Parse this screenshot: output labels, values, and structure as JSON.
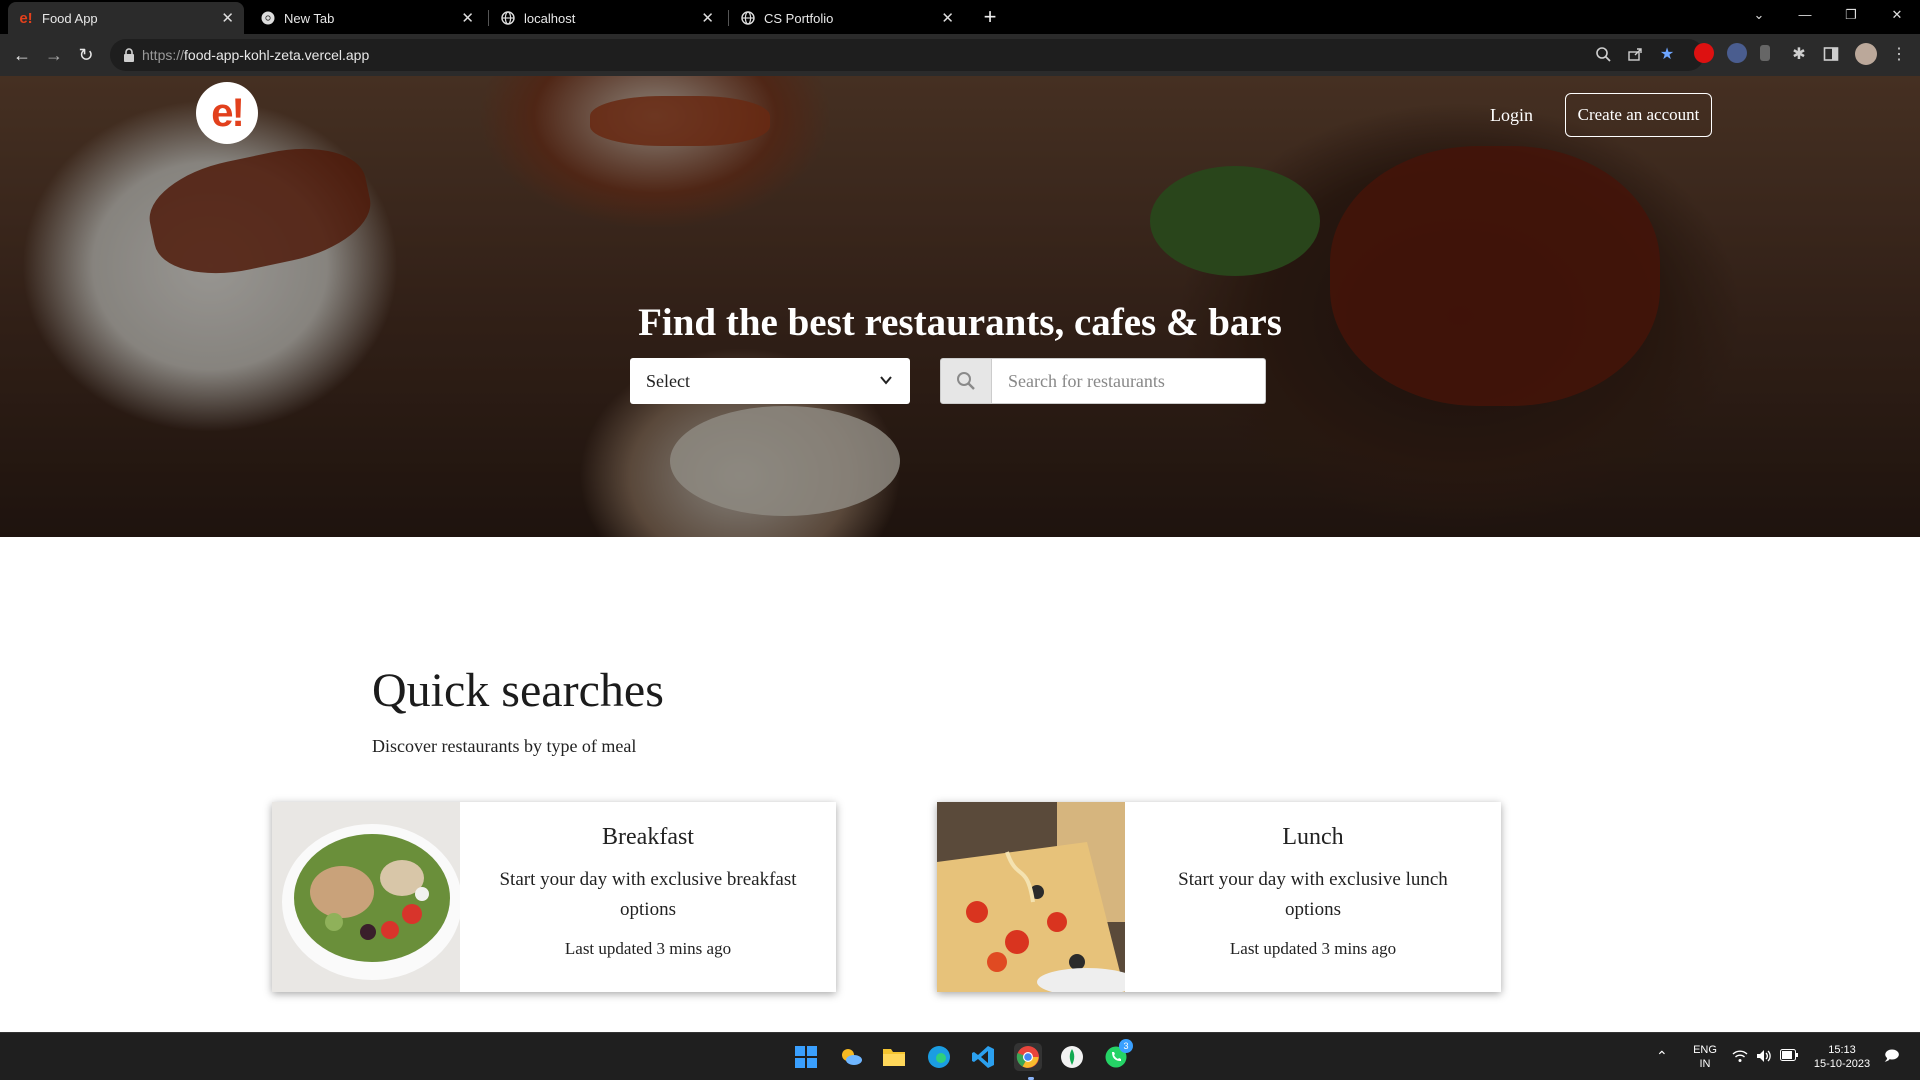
{
  "browser": {
    "tabs": [
      {
        "title": "Food App",
        "active": true,
        "favicon": "e!"
      },
      {
        "title": "New Tab",
        "active": false,
        "favicon": "chrome-icon"
      },
      {
        "title": "localhost",
        "active": false,
        "favicon": "globe-icon"
      },
      {
        "title": "CS Portfolio",
        "active": false,
        "favicon": "globe-icon"
      }
    ],
    "url_scheme": "https://",
    "url_host": "food-app-kohl-zeta.vercel.app"
  },
  "header": {
    "logo": "e!",
    "login_label": "Login",
    "create_account_label": "Create an account"
  },
  "hero": {
    "headline": "Find the best restaurants, cafes & bars",
    "location_select_value": "Select",
    "search_placeholder": "Search for restaurants"
  },
  "quick_searches": {
    "title": "Quick searches",
    "subtitle": "Discover restaurants by type of meal",
    "cards": [
      {
        "title": "Breakfast",
        "description": "Start your day with exclusive breakfast options",
        "updated": "Last updated 3 mins ago"
      },
      {
        "title": "Lunch",
        "description": "Start your day with exclusive lunch options",
        "updated": "Last updated 3 mins ago"
      }
    ]
  },
  "taskbar": {
    "lang_top": "ENG",
    "lang_bottom": "IN",
    "time": "15:13",
    "date": "15-10-2023",
    "whatsapp_badge": "3"
  },
  "colors": {
    "brand": "#e2401c",
    "chrome_bg": "#000000",
    "omnibox_bg": "#1e1e1e",
    "taskbar_bg": "#1f1f1f"
  }
}
